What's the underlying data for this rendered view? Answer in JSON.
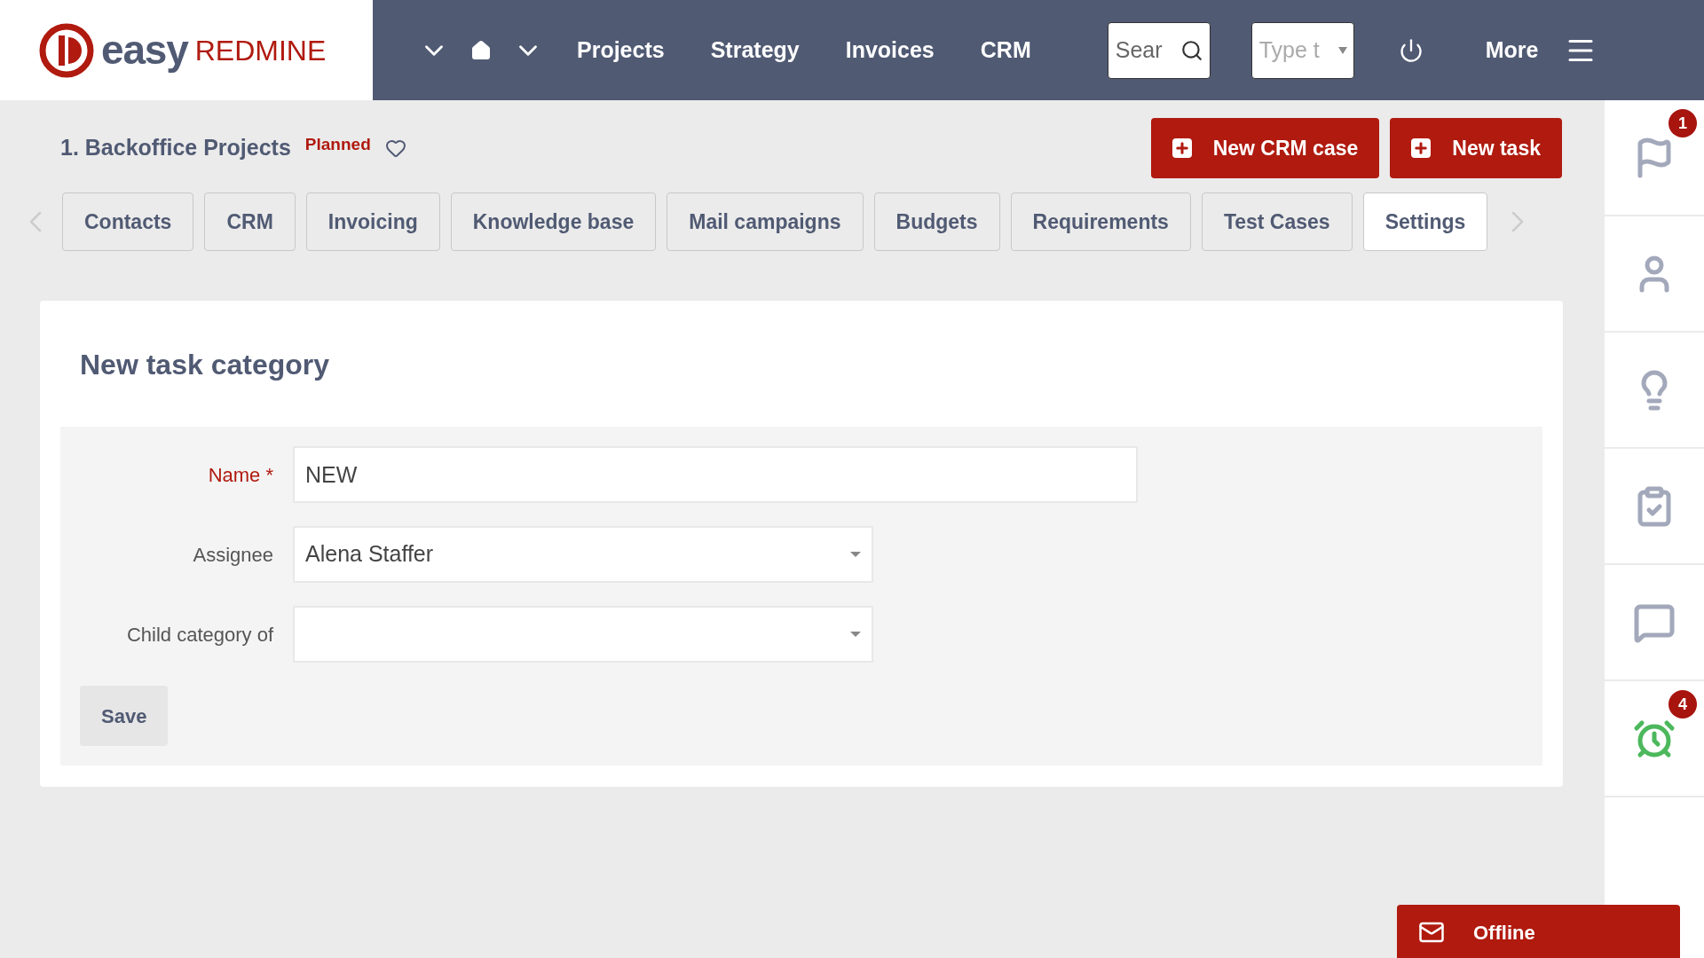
{
  "header": {
    "logo": {
      "word_1": "easy",
      "word_2": "REDMINE"
    },
    "nav": [
      {
        "kind": "caret"
      },
      {
        "kind": "home"
      },
      {
        "kind": "caret"
      },
      {
        "kind": "link",
        "label": "Projects"
      },
      {
        "kind": "link",
        "label": "Strategy"
      },
      {
        "kind": "link",
        "label": "Invoices"
      },
      {
        "kind": "link",
        "label": "CRM"
      }
    ],
    "search": {
      "placeholder": "Sear"
    },
    "jump": {
      "placeholder": "Type t"
    },
    "more": "More"
  },
  "project": {
    "title": "1. Backoffice Projects",
    "status": "Planned",
    "favorite": false
  },
  "actions": [
    "New CRM case",
    "New task"
  ],
  "tabs": [
    {
      "label": "Contacts",
      "selected": false
    },
    {
      "label": "CRM",
      "selected": false
    },
    {
      "label": "Invoicing",
      "selected": false
    },
    {
      "label": "Knowledge base",
      "selected": false
    },
    {
      "label": "Mail campaigns",
      "selected": false
    },
    {
      "label": "Budgets",
      "selected": false
    },
    {
      "label": "Requirements",
      "selected": false
    },
    {
      "label": "Test Cases",
      "selected": false
    },
    {
      "label": "Settings",
      "selected": true
    }
  ],
  "form": {
    "title": "New task category",
    "fields": [
      {
        "kind": "text",
        "label": "Name *",
        "required": true,
        "value": "NEW"
      },
      {
        "kind": "select",
        "label": "Assignee",
        "required": false,
        "value": "Alena Staffer"
      },
      {
        "kind": "select",
        "label": "Child category of",
        "required": false
      }
    ],
    "save": "Save"
  },
  "sidebar": [
    {
      "kind": "flag",
      "badge": "1"
    },
    {
      "kind": "user"
    },
    {
      "kind": "bulb"
    },
    {
      "kind": "tasks"
    },
    {
      "kind": "chat"
    },
    {
      "kind": "alarm",
      "badge": "4"
    }
  ],
  "chat_button": "Offline"
}
